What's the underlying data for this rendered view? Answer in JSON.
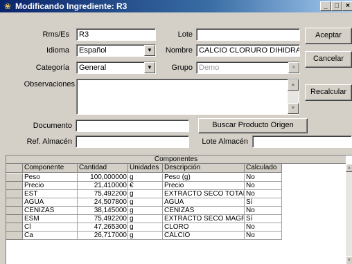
{
  "window": {
    "title": "Modificando Ingrediente: R3",
    "minimize": "_",
    "maximize": "□",
    "close": "×"
  },
  "form": {
    "rms_label": "Rms/Es",
    "rms_value": "R3",
    "idioma_label": "Idioma",
    "idioma_value": "Español",
    "categoria_label": "Categoría",
    "categoria_value": "General",
    "observaciones_label": "Observaciones",
    "lote_label": "Lote",
    "lote_value": "",
    "nombre_label": "Nombre",
    "nombre_value": "CALCIO CLORURO DIHIDRA",
    "grupo_label": "Grupo",
    "grupo_value": "Demo",
    "documento_label": "Documento",
    "documento_value": "",
    "ref_almacen_label": "Ref. Almacén",
    "ref_almacen_value": "",
    "lote_almacen_label": "Lote Almacén",
    "lote_almacen_value": ""
  },
  "buttons": {
    "aceptar": "Aceptar",
    "cancelar": "Cancelar",
    "recalcular": "Recalcular",
    "buscar": "Buscar Producto Origen"
  },
  "grid": {
    "caption": "Componentes",
    "columns": [
      "Componente",
      "Cantidad",
      "Unidades",
      "Descripción",
      "Calculado"
    ],
    "rows": [
      [
        "Peso",
        "100,000000",
        "g",
        "Peso (g)",
        "No"
      ],
      [
        "Precio",
        "21,410000",
        "€",
        "Precio",
        "No"
      ],
      [
        "EST",
        "75,492200",
        "g",
        "EXTRACTO SECO TOTAL",
        "No"
      ],
      [
        "AGUA",
        "24,507800",
        "g",
        "AGUA",
        "Sí"
      ],
      [
        "CENIZAS",
        "38,145000",
        "g",
        "CENIZAS",
        "No"
      ],
      [
        "ESM",
        "75,492200",
        "g",
        "EXTRACTO SECO MAGRO",
        "Sí"
      ],
      [
        "Cl",
        "47,265300",
        "g",
        "CLORO",
        "No"
      ],
      [
        "Ca",
        "26,717000",
        "g",
        "CALCIO",
        "No"
      ]
    ]
  }
}
